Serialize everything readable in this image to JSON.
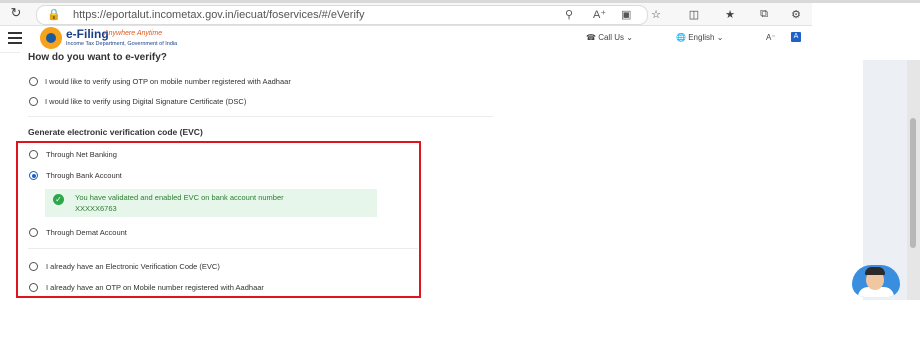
{
  "browser": {
    "url": "https://eportalut.incometax.gov.in/iecuat/foservices/#/eVerify"
  },
  "header": {
    "logo_main": "e-Filing",
    "logo_tagline": "Anywhere Anytime",
    "logo_sub": "Income Tax Department, Government of India",
    "call_us": "Call Us",
    "language": "English",
    "text_size": "A⁻",
    "a_badge": "A"
  },
  "main": {
    "question": "How do you want to e-verify?",
    "verify_options": [
      "I would like to verify using OTP on mobile number registered with Aadhaar",
      "I would like to verify using Digital Signature Certificate (DSC)"
    ],
    "evc_heading": "Generate electronic verification code (EVC)",
    "evc_options": [
      "Through Net Banking",
      "Through Bank Account",
      "Through Demat Account"
    ],
    "evc_note_line1": "You have validated and enabled EVC on bank account number",
    "evc_note_line2": "XXXXX6763",
    "existing_options": [
      "I already have an Electronic Verification Code (EVC)",
      "I already have an OTP on Mobile number registered with Aadhaar"
    ],
    "selected_option": "Through Bank Account"
  },
  "colors": {
    "accent": "#1e62c9",
    "highlight_box": "#e0141e",
    "success": "#2ea64a"
  }
}
